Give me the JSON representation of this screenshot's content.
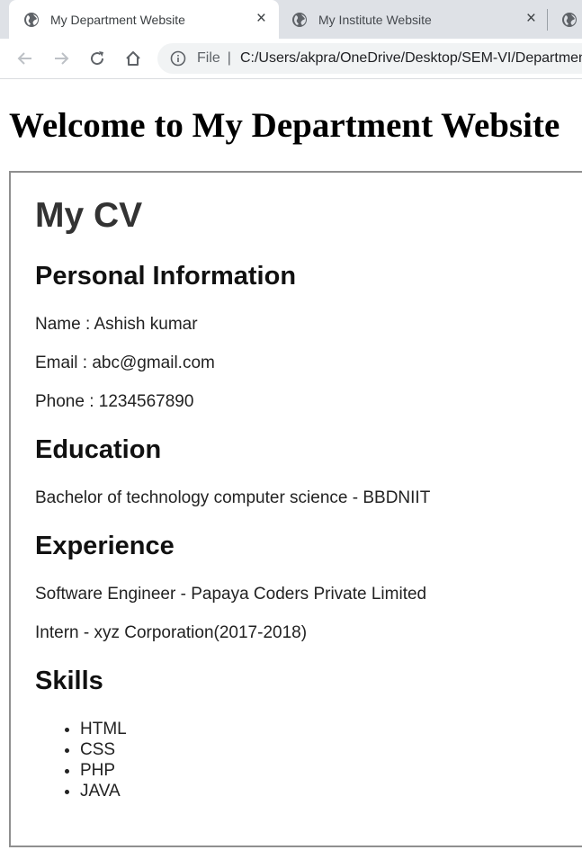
{
  "browser": {
    "tabs": [
      {
        "title": "My Department Website",
        "close": "×"
      },
      {
        "title": "My Institute Website",
        "close": "×"
      }
    ],
    "address": {
      "scheme": "File",
      "separator": "|",
      "url": "C:/Users/akpra/OneDrive/Desktop/SEM-VI/Department"
    }
  },
  "page": {
    "heading": "Welcome to My Department Website",
    "cv": {
      "title": "My CV",
      "personal": {
        "heading": "Personal Information",
        "name": "Name : Ashish kumar",
        "email": "Email : abc@gmail.com",
        "phone": "Phone : 1234567890"
      },
      "education": {
        "heading": "Education",
        "items": [
          "Bachelor of technology computer science - BBDNIIT"
        ]
      },
      "experience": {
        "heading": "Experience",
        "items": [
          "Software Engineer - Papaya Coders Private Limited",
          "Intern - xyz Corporation(2017-2018)"
        ]
      },
      "skills": {
        "heading": "Skills",
        "items": [
          "HTML",
          "CSS",
          "PHP",
          "JAVA"
        ]
      }
    }
  }
}
